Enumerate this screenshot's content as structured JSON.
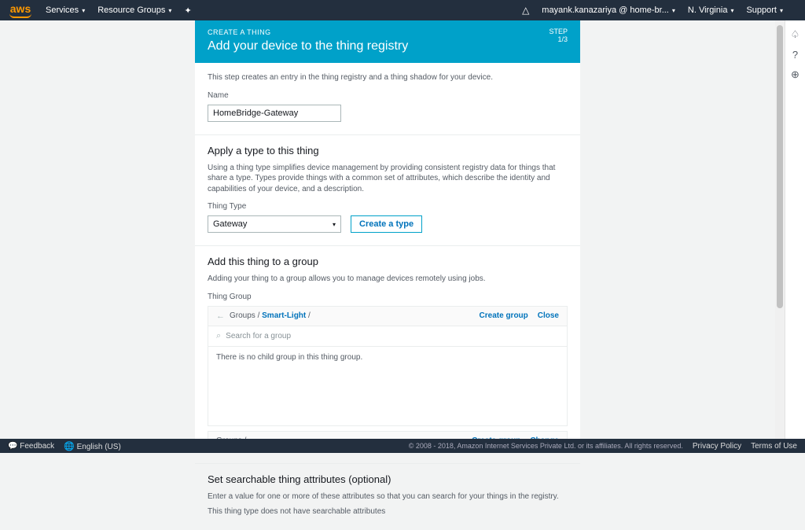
{
  "nav": {
    "logo": "aws",
    "services": "Services",
    "resource_groups": "Resource Groups",
    "account": "mayank.kanazariya @ home-br...",
    "region": "N. Virginia",
    "support": "Support"
  },
  "banner": {
    "kicker": "CREATE A THING",
    "title": "Add your device to the thing registry",
    "step_label": "STEP",
    "step_num": "1/3"
  },
  "intro": {
    "desc": "This step creates an entry in the thing registry and a thing shadow for your device.",
    "name_label": "Name",
    "name_value": "HomeBridge-Gateway"
  },
  "type": {
    "heading": "Apply a type to this thing",
    "desc": "Using a thing type simplifies device management by providing consistent registry data for things that share a type. Types provide things with a common set of attributes, which describe the identity and capabilities of your device, and a description.",
    "label": "Thing Type",
    "value": "Gateway",
    "create_btn": "Create a type"
  },
  "group": {
    "heading": "Add this thing to a group",
    "desc": "Adding your thing to a group allows you to manage devices remotely using jobs.",
    "label": "Thing Group",
    "crumb_root": "Groups",
    "crumb_current": "Smart-Light",
    "create": "Create group",
    "close": "Close",
    "search_placeholder": "Search for a group",
    "empty": "There is no child group in this thing group.",
    "foot_crumb": "Groups",
    "foot_create": "Create group",
    "foot_change": "Change"
  },
  "attrs": {
    "heading": "Set searchable thing attributes (optional)",
    "desc": "Enter a value for one or more of these attributes so that you can search for your things in the registry.",
    "note": "This thing type does not have searchable attributes"
  },
  "footer": {
    "feedback": "Feedback",
    "lang": "English (US)",
    "copyright": "© 2008 - 2018, Amazon Internet Services Private Ltd. or its affiliates. All rights reserved.",
    "privacy": "Privacy Policy",
    "terms": "Terms of Use"
  }
}
